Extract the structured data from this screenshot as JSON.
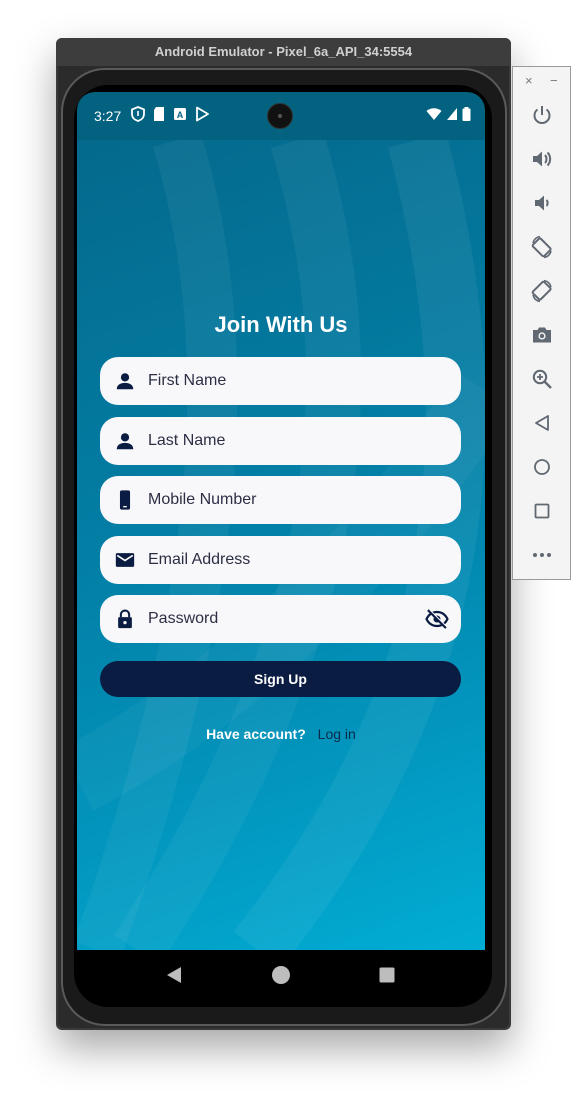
{
  "emulator": {
    "window_title": "Android Emulator - Pixel_6a_API_34:5554",
    "toolbar": {
      "close_label": "×",
      "minimize_label": "−",
      "buttons": [
        "power-icon",
        "volume-up-icon",
        "volume-down-icon",
        "rotate-left-icon",
        "rotate-right-icon",
        "camera-icon",
        "zoom-icon",
        "back-icon",
        "home-icon",
        "overview-icon",
        "more-icon"
      ]
    }
  },
  "status_bar": {
    "time": "3:27"
  },
  "app": {
    "title": "Join With Us",
    "fields": {
      "first_name": {
        "placeholder": "First Name",
        "value": "",
        "icon": "person-icon"
      },
      "last_name": {
        "placeholder": "Last Name",
        "value": "",
        "icon": "person-icon"
      },
      "mobile": {
        "placeholder": "Mobile Number",
        "value": "",
        "icon": "phone-icon"
      },
      "email": {
        "placeholder": "Email Address",
        "value": "",
        "icon": "mail-icon"
      },
      "password": {
        "placeholder": "Password",
        "value": "",
        "icon": "lock-icon",
        "visibility_icon": "visibility-off-icon"
      }
    },
    "signup_label": "Sign Up",
    "have_account_text": "Have account?",
    "login_label": "Log in"
  },
  "colors": {
    "primary_dark": "#0b1c42",
    "bg_gradient_start": "#04698c",
    "bg_gradient_end": "#01add4",
    "field_bg": "#f8f8fa"
  }
}
